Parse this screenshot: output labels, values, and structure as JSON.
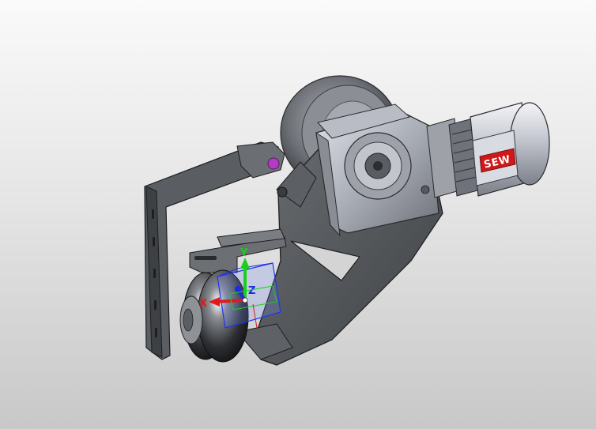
{
  "viewport": {
    "colors": {
      "background_top": "#fafafa",
      "background_bottom": "#c8c8c8",
      "metal_dark": "#4a4d52",
      "metal_light": "#c9ccd4",
      "bracket": "#55585c",
      "accent_purple": "#b23cc4"
    }
  },
  "triad": {
    "x_label": "X",
    "y_label": "Y",
    "z_label": "Z",
    "x_color": "#e01a1a",
    "y_color": "#1bcf1b",
    "z_color": "#1a2be0"
  },
  "motor": {
    "brand_label": "SEW",
    "brand_color": "#d01818"
  }
}
